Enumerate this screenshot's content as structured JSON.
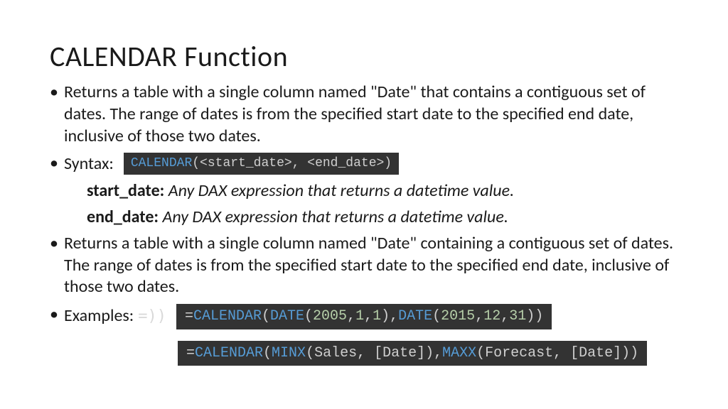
{
  "title": "CALENDAR Function",
  "bullets": {
    "b1": "Returns a table with a single column named \"Date\" that contains a contiguous set of dates. The range of dates is from the specified start date to the specified end date, inclusive of those two dates.",
    "syntax_label": "Syntax:",
    "params": {
      "p1_name": "start_date:",
      "p1_desc": " Any DAX expression that returns a datetime value.",
      "p2_name": "end_date:",
      "p2_desc": " Any DAX expression that returns a datetime value."
    },
    "b3": "Returns a table with a single column named \"Date\" containing a contiguous set of dates. The range of dates is from the specified start date to the specified end date, inclusive of those two dates.",
    "examples_label": "Examples:",
    "faded": "=))"
  },
  "code": {
    "syntax": {
      "fn": "CALENDAR",
      "args": "(<start_date>, <end_date>)"
    },
    "ex1": {
      "eq": "= ",
      "fn1": "CALENDAR ",
      "p1": "(",
      "fn2": "DATE ",
      "args1a": "(",
      "n1": "2005",
      "c1": ", ",
      "n2": "1",
      "c2": ", ",
      "n3": "1",
      "args1b": "), ",
      "fn3": "DATE ",
      "args2a": "(",
      "n4": "2015",
      "c3": ", ",
      "n5": "12",
      "c4": ", ",
      "n6": "31",
      "args2b": "))"
    },
    "ex2": {
      "eq": "= ",
      "fn1": "CALENDAR ",
      "p1": "(",
      "fn2": "MINX ",
      "args1": "(Sales, [Date]), ",
      "fn3": "MAXX ",
      "args2": "(Forecast, [Date]))"
    }
  }
}
